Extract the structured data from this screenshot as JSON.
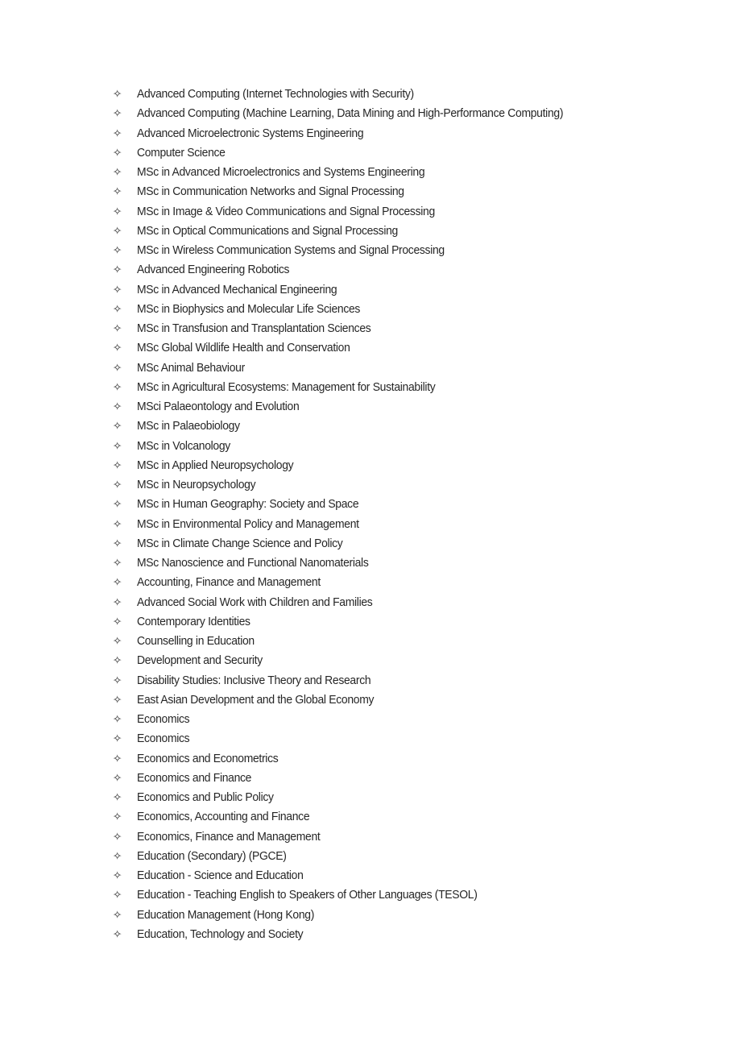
{
  "document": {
    "background_color": "#ffffff",
    "text_color": "#262626",
    "bullet_glyph": "✧",
    "bullet_icon_name": "four-pointed-star-bullet-icon"
  },
  "list": {
    "name": "postgraduate-programme-list",
    "item_count": 44,
    "items": [
      {
        "label": "Advanced Computing (Internet Technologies with Security)"
      },
      {
        "label": "Advanced Computing (Machine Learning, Data Mining and High-Performance Computing)"
      },
      {
        "label": "Advanced Microelectronic Systems Engineering"
      },
      {
        "label": "Computer Science"
      },
      {
        "label": "MSc in Advanced Microelectronics and Systems Engineering"
      },
      {
        "label": "MSc in Communication Networks and Signal Processing"
      },
      {
        "label": "MSc in Image & Video Communications and Signal Processing"
      },
      {
        "label": "MSc in Optical Communications and Signal Processing"
      },
      {
        "label": "MSc in Wireless Communication Systems and Signal Processing"
      },
      {
        "label": "Advanced Engineering Robotics"
      },
      {
        "label": "MSc in Advanced Mechanical Engineering"
      },
      {
        "label": "MSc in Biophysics and Molecular Life Sciences"
      },
      {
        "label": "MSc in Transfusion and Transplantation Sciences"
      },
      {
        "label": "MSc Global Wildlife Health and Conservation"
      },
      {
        "label": "MSc Animal Behaviour"
      },
      {
        "label": "MSc in Agricultural Ecosystems: Management for Sustainability"
      },
      {
        "label": "MSci Palaeontology and Evolution"
      },
      {
        "label": "MSc in Palaeobiology"
      },
      {
        "label": "MSc in Volcanology"
      },
      {
        "label": "MSc in Applied Neuropsychology"
      },
      {
        "label": "MSc in Neuropsychology"
      },
      {
        "label": "MSc in Human Geography: Society and Space"
      },
      {
        "label": "MSc in Environmental Policy and Management"
      },
      {
        "label": "MSc in Climate Change Science and Policy"
      },
      {
        "label": "MSc Nanoscience and Functional Nanomaterials"
      },
      {
        "label": "Accounting, Finance and Management"
      },
      {
        "label": "Advanced Social Work with Children and Families"
      },
      {
        "label": "Contemporary Identities"
      },
      {
        "label": "Counselling in Education"
      },
      {
        "label": "Development and Security"
      },
      {
        "label": "Disability Studies: Inclusive Theory and Research"
      },
      {
        "label": "East Asian Development and the Global Economy"
      },
      {
        "label": "Economics"
      },
      {
        "label": "Economics"
      },
      {
        "label": "Economics and Econometrics"
      },
      {
        "label": "Economics and Finance"
      },
      {
        "label": "Economics and Public Policy"
      },
      {
        "label": "Economics, Accounting and Finance"
      },
      {
        "label": "Economics, Finance and Management"
      },
      {
        "label": "Education (Secondary) (PGCE)"
      },
      {
        "label": "Education - Science and Education"
      },
      {
        "label": "Education - Teaching English to Speakers of Other Languages (TESOL)"
      },
      {
        "label": "Education Management (Hong Kong)"
      },
      {
        "label": "Education, Technology and Society"
      }
    ]
  }
}
